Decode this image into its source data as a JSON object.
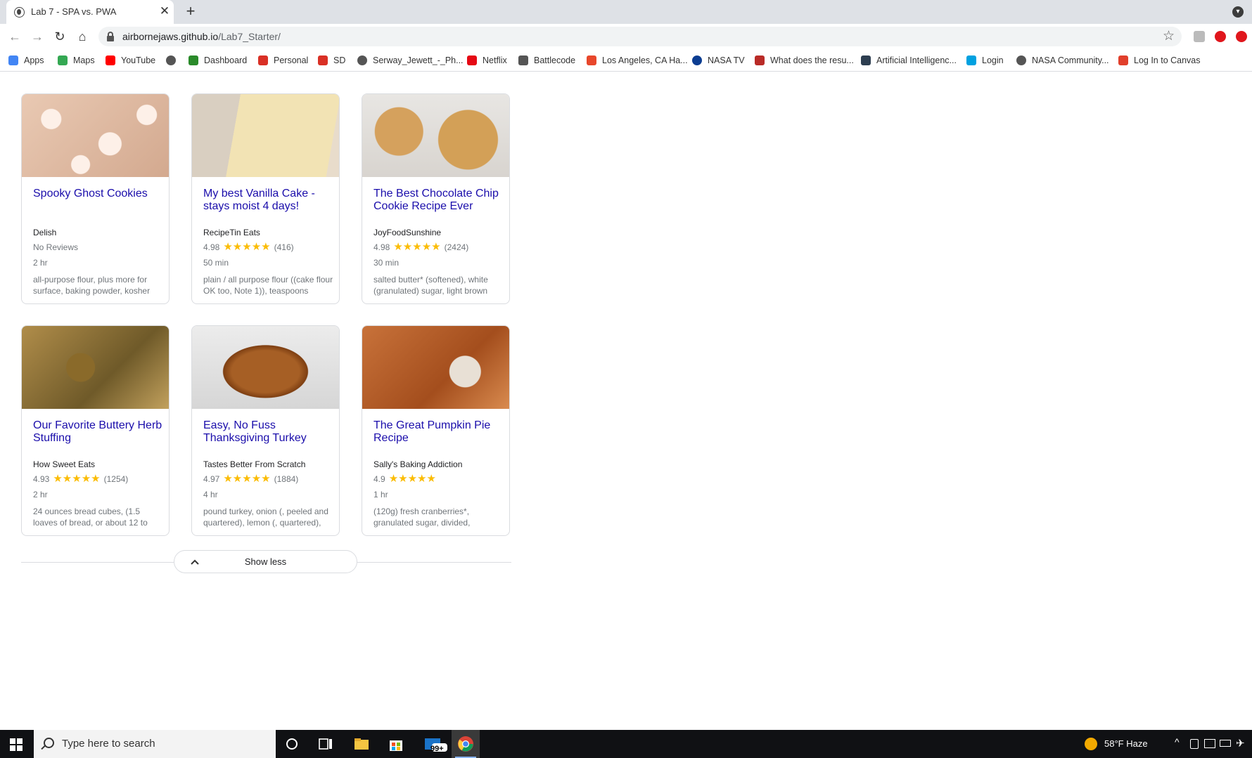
{
  "browser": {
    "tab_title": "Lab 7 - SPA vs. PWA",
    "url_host": "airbornejaws.github.io",
    "url_path": "/Lab7_Starter/"
  },
  "bookmarks": [
    {
      "label": "Apps",
      "icon": "apps-grid-icon",
      "color": "#4285f4"
    },
    {
      "label": "Maps",
      "icon": "maps-pin-icon",
      "color": "#34a853"
    },
    {
      "label": "YouTube",
      "icon": "youtube-icon",
      "color": "#ff0000"
    },
    {
      "label": "",
      "icon": "globe-icon",
      "color": "#555555"
    },
    {
      "label": "Dashboard",
      "icon": "dashboard-icon",
      "color": "#2a8a2a"
    },
    {
      "label": "Personal",
      "icon": "gmail-icon",
      "color": "#d93025"
    },
    {
      "label": "SD",
      "icon": "gmail-icon",
      "color": "#d93025"
    },
    {
      "label": "Serway_Jewett_-_Ph...",
      "icon": "globe-icon",
      "color": "#555555"
    },
    {
      "label": "Netflix",
      "icon": "netflix-icon",
      "color": "#e50914"
    },
    {
      "label": "Battlecode",
      "icon": "battlecode-icon",
      "color": "#555555"
    },
    {
      "label": "Los Angeles, CA Ha...",
      "icon": "weather-icon",
      "color": "#e8472b"
    },
    {
      "label": "NASA TV",
      "icon": "nasa-icon",
      "color": "#0b3d91"
    },
    {
      "label": "What does the resu...",
      "icon": "quora-icon",
      "color": "#b92b27"
    },
    {
      "label": "Artificial Intelligenc...",
      "icon": "h-icon",
      "color": "#2d3e50"
    },
    {
      "label": "Login",
      "icon": "salesforce-icon",
      "color": "#00a1e0"
    },
    {
      "label": "NASA Community...",
      "icon": "globe-icon",
      "color": "#555555"
    },
    {
      "label": "Log In to Canvas",
      "icon": "canvas-icon",
      "color": "#e13f2b"
    }
  ],
  "recipes": [
    {
      "title": "Spooky Ghost Cookies",
      "org": "Delish",
      "rating": "No Reviews",
      "stars": "",
      "count": "",
      "time": "2 hr",
      "ingredients": "all-purpose flour, plus more for surface, baking powder, kosher"
    },
    {
      "title": "My best Vanilla Cake - stays moist 4 days!",
      "org": "RecipeTin Eats",
      "rating": "4.98",
      "stars": "★★★★★",
      "count": "(416)",
      "time": "50 min",
      "ingredients": "plain / all purpose flour ((cake flour OK too, Note 1)), teaspoons"
    },
    {
      "title": "The Best Chocolate Chip Cookie Recipe Ever",
      "org": "JoyFoodSunshine",
      "rating": "4.98",
      "stars": "★★★★★",
      "count": "(2424)",
      "time": "30 min",
      "ingredients": "salted butter* (softened), white (granulated) sugar, light brown"
    },
    {
      "title": "Our Favorite Buttery Herb Stuffing",
      "org": "How Sweet Eats",
      "rating": "4.93",
      "stars": "★★★★★",
      "count": "(1254)",
      "time": "2 hr",
      "ingredients": "24 ounces bread cubes, (1.5 loaves of bread, or about 12 to"
    },
    {
      "title": "Easy, No Fuss Thanksgiving Turkey",
      "org": "Tastes Better From Scratch",
      "rating": "4.97",
      "stars": "★★★★★",
      "count": "(1884)",
      "time": "4 hr",
      "ingredients": "pound turkey, onion (, peeled and quartered), lemon (, quartered),"
    },
    {
      "title": "The Great Pumpkin Pie Recipe",
      "org": "Sally's Baking Addiction",
      "rating": "4.9",
      "stars": "★★★★★",
      "count": "",
      "time": "1 hr",
      "ingredients": "(120g) fresh cranberries*, granulated sugar, divided,"
    }
  ],
  "show_less_label": "Show less",
  "taskbar": {
    "search_placeholder": "Type here to search",
    "mail_badge": "99+",
    "weather": "58°F  Haze"
  },
  "colors": {
    "link": "#1a0dab",
    "star": "#fbbc04"
  }
}
